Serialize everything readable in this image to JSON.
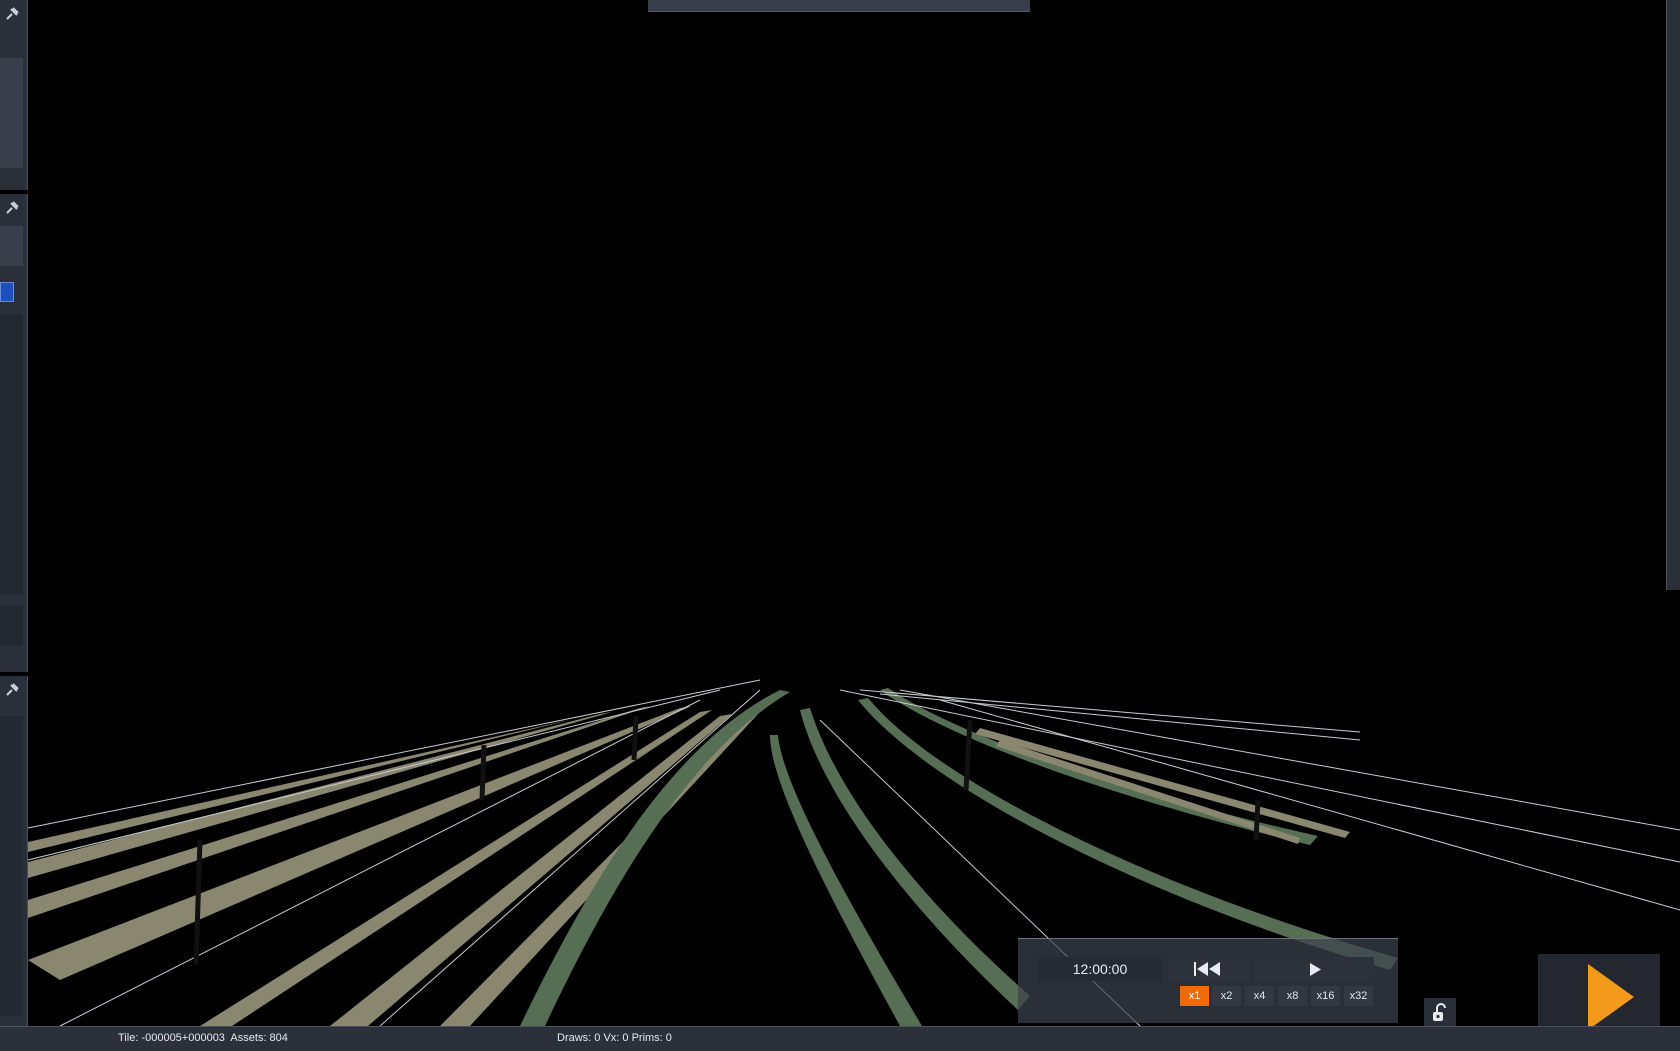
{
  "viewport": {
    "description_color_bg": "#000000",
    "rail_colors": {
      "green": "#566f54",
      "tan": "#8a8770",
      "wire": "#c9ccd2"
    }
  },
  "left_dock": {
    "pin_icon": "pin-icon",
    "accent_color": "#1d4fbf"
  },
  "playback": {
    "time": "12:00:00",
    "rewind_icon": "skip-back-icon",
    "play_icon": "play-icon",
    "speeds": [
      "x1",
      "x2",
      "x4",
      "x8",
      "x16",
      "x32"
    ],
    "active_speed": "x1",
    "active_color": "#f06a0a",
    "lock_icon": "unlock-icon",
    "big_play_icon": "big-play-icon",
    "big_play_color": "#f39a1c"
  },
  "status_bar": {
    "tile_text": "Tile: -000005+000003  Assets: 804",
    "draw_text": "Draws: 0 Vx: 0 Prims: 0"
  }
}
